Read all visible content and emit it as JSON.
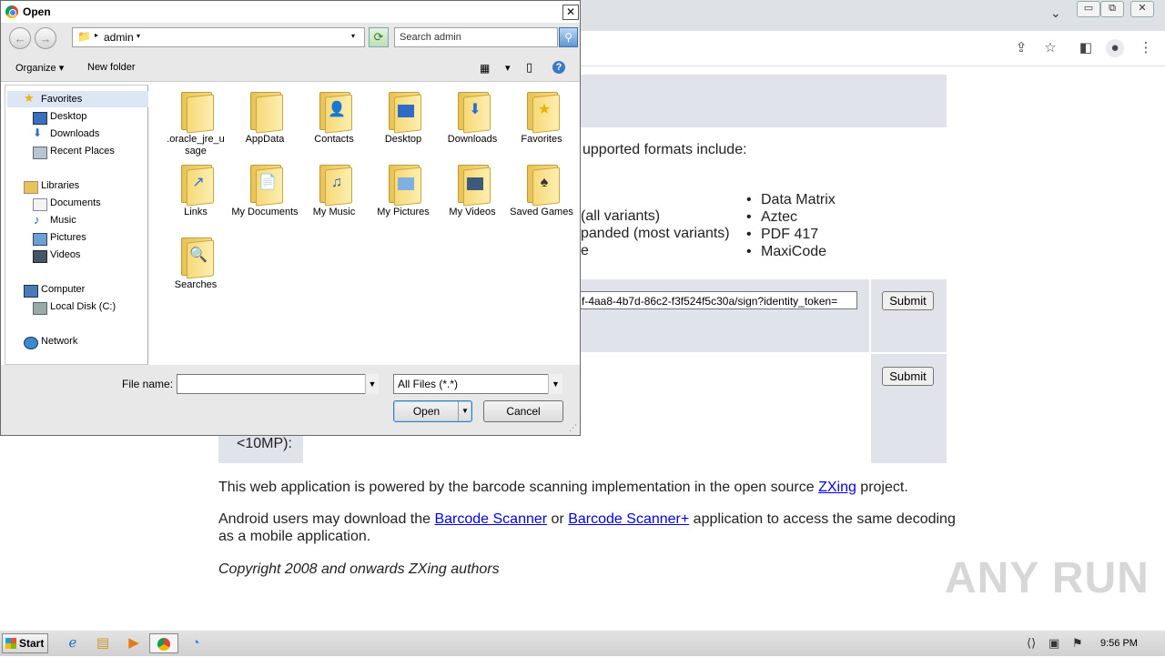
{
  "browser": {
    "chevron": "⌄",
    "window_controls": [
      "▭",
      "⧉",
      "✕"
    ],
    "toolbar_icons": [
      "share-icon",
      "star-icon",
      "sidebar-icon",
      "profile-icon",
      "menu-icon"
    ]
  },
  "page": {
    "supported_formats_text": "upported formats include:",
    "formats_right": [
      "Data Matrix",
      "Aztec",
      "PDF 417",
      "MaxiCode"
    ],
    "formats_left_partial": [
      "(all variants)",
      "panded (most variants)",
      "e"
    ],
    "url_value": "f-4aa8-4b7d-86c2-f3f524f5c30a/sign?identity_token=",
    "submit_label": "Submit",
    "file_size_label": "<10MP):",
    "powered_prefix": "This web application is powered by the barcode scanning implementation in the open source ",
    "powered_link": "ZXing",
    "powered_suffix": " project.",
    "android_prefix": "Android users may download the ",
    "android_link1": "Barcode Scanner",
    "android_mid": " or ",
    "android_link2": "Barcode Scanner+",
    "android_suffix": " application to access the same decoding",
    "android_line2": "as a mobile application.",
    "copyright": "Copyright 2008 and onwards ZXing authors",
    "watermark": "ANY RUN"
  },
  "dialog": {
    "title": "Open",
    "close": "✕",
    "address": "admin",
    "search_placeholder": "Search admin",
    "toolbar": {
      "organize": "Organize",
      "new_folder": "New folder"
    },
    "nav": {
      "favorites": "Favorites",
      "desktop": "Desktop",
      "downloads": "Downloads",
      "recent_places": "Recent Places",
      "libraries": "Libraries",
      "documents": "Documents",
      "music": "Music",
      "pictures": "Pictures",
      "videos": "Videos",
      "computer": "Computer",
      "local_disk": "Local Disk (C:)",
      "network": "Network"
    },
    "files": [
      {
        "name": ".oracle_jre_u sage",
        "icon": "folder-icon"
      },
      {
        "name": "AppData",
        "icon": "folder-icon"
      },
      {
        "name": "Contacts",
        "icon": "contacts-folder-icon"
      },
      {
        "name": "Desktop",
        "icon": "desktop-folder-icon"
      },
      {
        "name": "Downloads",
        "icon": "downloads-folder-icon"
      },
      {
        "name": "Favorites",
        "icon": "favorites-folder-icon"
      },
      {
        "name": "Links",
        "icon": "links-folder-icon"
      },
      {
        "name": "My Documents",
        "icon": "documents-folder-icon"
      },
      {
        "name": "My Music",
        "icon": "music-folder-icon"
      },
      {
        "name": "My Pictures",
        "icon": "pictures-folder-icon"
      },
      {
        "name": "My Videos",
        "icon": "videos-folder-icon"
      },
      {
        "name": "Saved Games",
        "icon": "saved-games-folder-icon"
      },
      {
        "name": "Searches",
        "icon": "searches-folder-icon"
      }
    ],
    "file_name_label": "File name:",
    "file_name_value": "",
    "filter": "All Files (*.*)",
    "open_label": "Open",
    "cancel_label": "Cancel"
  },
  "taskbar": {
    "start": "Start",
    "clock": "9:56 PM"
  }
}
